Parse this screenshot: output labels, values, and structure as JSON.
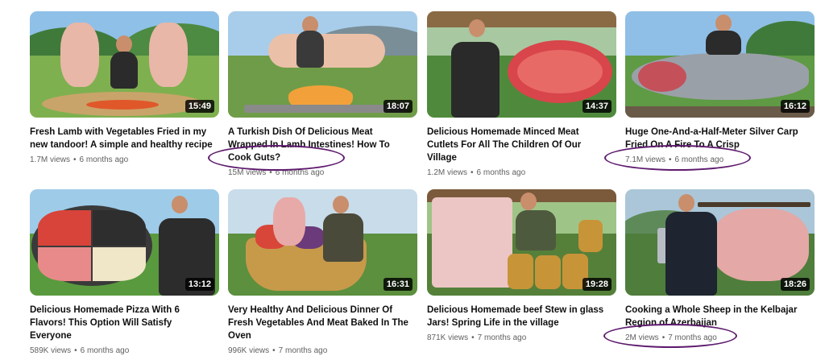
{
  "videos": [
    {
      "title": "Fresh Lamb with Vegetables Fried in my new tandoor! A simple and healthy recipe",
      "views": "1.7M views",
      "age": "6 months ago",
      "duration": "15:49"
    },
    {
      "title": "A Turkish Dish Of Delicious Meat Wrapped In Lamb Intestines! How To Cook Guts?",
      "views": "15M views",
      "age": "6 months ago",
      "duration": "18:07"
    },
    {
      "title": "Delicious Homemade Minced Meat Cutlets For All The Children Of Our Village",
      "views": "1.2M views",
      "age": "6 months ago",
      "duration": "14:37"
    },
    {
      "title": "Huge One-And-a-Half-Meter Silver Carp Fried On A Fire To A Crisp",
      "views": "7.1M views",
      "age": "6 months ago",
      "duration": "16:12"
    },
    {
      "title": "Delicious Homemade Pizza With 6 Flavors! This Option Will Satisfy Everyone",
      "views": "589K views",
      "age": "6 months ago",
      "duration": "13:12"
    },
    {
      "title": "Very Healthy And Delicious Dinner Of Fresh Vegetables And Meat Baked In The Oven",
      "views": "996K views",
      "age": "7 months ago",
      "duration": "16:31"
    },
    {
      "title": "Delicious Homemade beef Stew in glass Jars! Spring Life in the village",
      "views": "871K views",
      "age": "7 months ago",
      "duration": "19:28"
    },
    {
      "title": "Cooking a Whole Sheep in the Kelbajar Region of Azerbaijan",
      "views": "2M views",
      "age": "7 months ago",
      "duration": "18:26"
    }
  ],
  "meta_separator": "•",
  "colors": {
    "annotation_circle": "#5e1a6e",
    "duration_badge": "#000000",
    "title_text": "#0f0f0f",
    "meta_text": "#606060"
  }
}
